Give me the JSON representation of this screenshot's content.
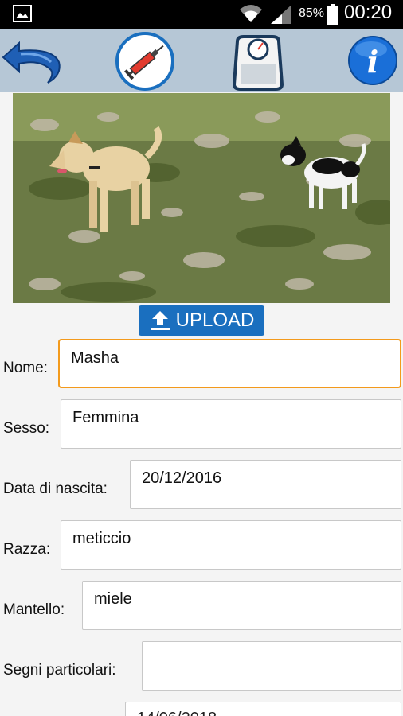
{
  "status_bar": {
    "battery_percent": "85%",
    "time": "00:20",
    "icons": [
      "gallery-icon",
      "wifi-icon",
      "signal-icon",
      "battery-icon"
    ]
  },
  "toolbar": {
    "buttons": [
      "back-icon",
      "syringe-icon",
      "scale-icon",
      "info-icon"
    ]
  },
  "photo": {
    "description_icon": "dogs-photo"
  },
  "upload": {
    "label": "UPLOAD",
    "icon": "upload-icon"
  },
  "form": {
    "nome": {
      "label": "Nome:",
      "value": "Masha"
    },
    "sesso": {
      "label": "Sesso:",
      "value": "Femmina"
    },
    "data_nascita": {
      "label": "Data di nascita:",
      "value": "20/12/2016"
    },
    "razza": {
      "label": "Razza:",
      "value": "meticcio"
    },
    "mantello": {
      "label": "Mantello:",
      "value": "miele"
    },
    "segni": {
      "label": "Segni particolari:",
      "value": ""
    },
    "next": {
      "value": "14/06/2018"
    }
  },
  "colors": {
    "toolbar_bg": "#b6c7d6",
    "upload_bg": "#1a6fbf",
    "focus_border": "#f39a1c"
  }
}
